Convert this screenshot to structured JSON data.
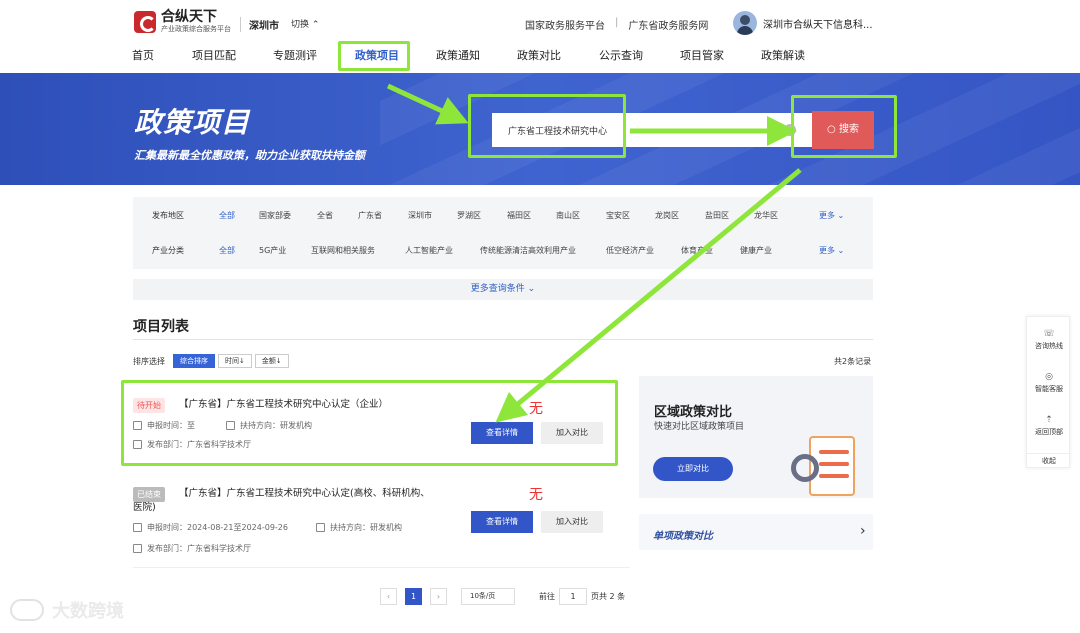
{
  "header": {
    "brand": "合纵天下",
    "brand_sub": "产业政策综合服务平台",
    "city": "深圳市",
    "switch_label": "切换",
    "links": [
      "国家政务服务平台",
      "广东省政务服务网"
    ],
    "link_sep": "|",
    "user_name": "深圳市合纵天下信息科..."
  },
  "nav": [
    "首页",
    "项目匹配",
    "专题测评",
    "政策项目",
    "政策通知",
    "政策对比",
    "公示查询",
    "项目管家",
    "政策解读"
  ],
  "banner": {
    "title": "政策项目",
    "subtitle": "汇集最新最全优惠政策，助力企业获取扶持金额",
    "search_value": "广东省工程技术研究中心",
    "clear_icon": "×",
    "search_button": "搜索"
  },
  "filters": {
    "region": {
      "label": "发布地区",
      "items": [
        "全部",
        "国家部委",
        "全省",
        "广东省",
        "深圳市",
        "罗湖区",
        "福田区",
        "南山区",
        "宝安区",
        "龙岗区",
        "盐田区",
        "龙华区"
      ],
      "more": "更多"
    },
    "industry": {
      "label": "产业分类",
      "items": [
        "全部",
        "5G产业",
        "互联网和相关服务",
        "人工智能产业",
        "传统能源清洁高效利用产业",
        "低空经济产业",
        "体育产业",
        "健康产业"
      ],
      "more": "更多"
    },
    "more_conditions": "更多查询条件"
  },
  "list": {
    "title": "项目列表",
    "sort_label": "排序选择",
    "sort_options": [
      "综合排序",
      "时间↓",
      "金额↓"
    ],
    "total": "共2条记录"
  },
  "projects": [
    {
      "status": "待开始",
      "title": "【广东省】广东省工程技术研究中心认定（企业）",
      "date_label": "申报时间：至",
      "direction": "扶持方向：研发机构",
      "dept": "发布部门：广东省科学技术厅",
      "amount": "无",
      "detail": "查看详情",
      "compare": "加入对比"
    },
    {
      "status": "已结束",
      "title": "【广东省】广东省工程技术研究中心认定(高校、科研机构、",
      "title2": "医院)",
      "date_label": "申报时间：2024-08-21至2024-09-26",
      "direction": "扶持方向：研发机构",
      "dept": "发布部门：广东省科学技术厅",
      "amount": "无",
      "detail": "查看详情",
      "compare": "加入对比"
    }
  ],
  "side": {
    "region_title": "区域政策对比",
    "region_sub": "快速对比区域政策项目",
    "region_btn": "立即对比",
    "single_title": "单项政策对比"
  },
  "pager": {
    "prev": "‹",
    "current": "1",
    "next": "›",
    "page_size": "10条/页",
    "goto_label": "前往",
    "goto_value": "1",
    "total_pages": "页共 2 条"
  },
  "float": [
    "咨询热线",
    "智能客服",
    "返回顶部",
    "收起"
  ],
  "watermark": "大数跨境",
  "colors": {
    "primary": "#3256c8",
    "highlight": "#8ee63a",
    "search_btn": "#e05a5a"
  }
}
